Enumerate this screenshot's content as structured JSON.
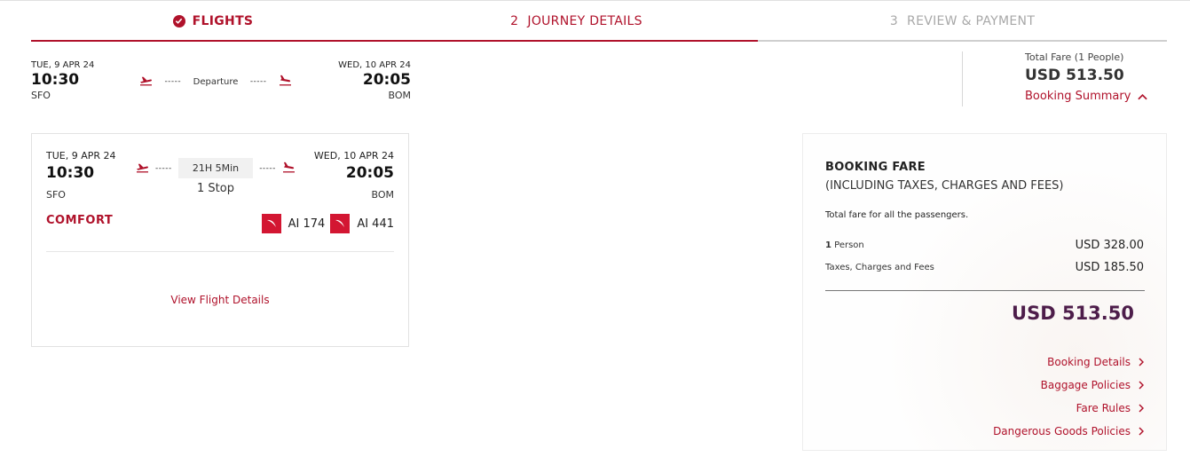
{
  "stepper": {
    "step1": {
      "label": "FLIGHTS",
      "state": "completed"
    },
    "step2": {
      "num": "2",
      "label": "JOURNEY DETAILS",
      "state": "active"
    },
    "step3": {
      "num": "3",
      "label": "REVIEW & PAYMENT",
      "state": "pending"
    }
  },
  "summary": {
    "depart_date": "TUE, 9 APR 24",
    "depart_time": "10:30",
    "depart_code": "SFO",
    "mid_label": "Departure",
    "arrive_date": "WED, 10 APR 24",
    "arrive_time": "20:05",
    "arrive_code": "BOM"
  },
  "total": {
    "label": "Total Fare (1 People)",
    "value": "USD 513.50",
    "booking_summary_label": "Booking Summary"
  },
  "flight_card": {
    "depart_date": "TUE, 9 APR 24",
    "depart_time": "10:30",
    "depart_code": "SFO",
    "duration": "21H 5Min",
    "stops": "1 Stop",
    "arrive_date": "WED, 10 APR 24",
    "arrive_time": "20:05",
    "arrive_code": "BOM",
    "cabin": "COMFORT",
    "flights": [
      "AI 174",
      "AI 441"
    ],
    "view_details_label": "View Flight Details"
  },
  "fare": {
    "title": "BOOKING FARE",
    "subtitle": "(INCLUDING TAXES, CHARGES AND FEES)",
    "note": "Total fare for all the passengers.",
    "person_count": "1",
    "person_label": "Person",
    "person_amount": "USD 328.00",
    "taxes_label": "Taxes, Charges and Fees",
    "taxes_amount": "USD 185.50",
    "total": "USD 513.50",
    "links": [
      "Booking Details",
      "Baggage Policies",
      "Fare Rules",
      "Dangerous Goods Policies"
    ]
  },
  "colors": {
    "brand_red": "#b0122b",
    "total_purple": "#4d1d4a",
    "pending_grey": "#a8a8a8"
  },
  "icons": {
    "check": "check-circle-icon",
    "takeoff": "plane-takeoff-icon",
    "landing": "plane-landing-icon",
    "chevron_up": "chevron-up-icon",
    "chevron_right": "chevron-right-icon",
    "airline_logo": "air-india-logo-icon"
  }
}
